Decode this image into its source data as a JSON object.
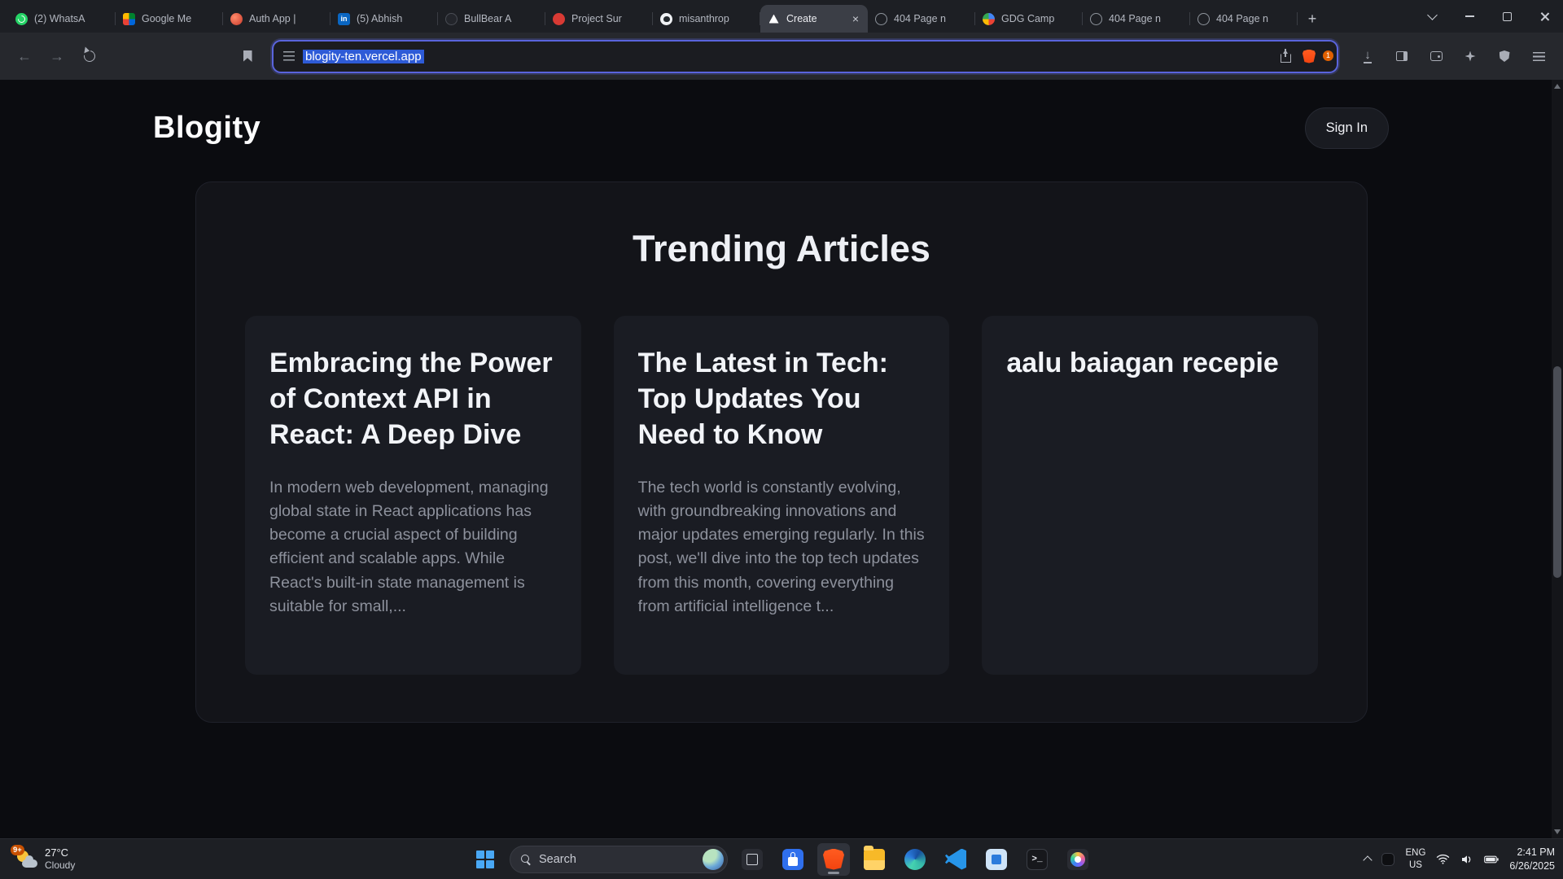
{
  "browser": {
    "tabs": [
      {
        "icon": "whatsapp",
        "title": "(2) WhatsA"
      },
      {
        "icon": "meet",
        "title": "Google Me"
      },
      {
        "icon": "auth",
        "title": "Auth App |"
      },
      {
        "icon": "linkedin",
        "title": "(5) Abhish"
      },
      {
        "icon": "bullbear",
        "title": "BullBear A"
      },
      {
        "icon": "project",
        "title": "Project Sur"
      },
      {
        "icon": "github",
        "title": "misanthrop"
      },
      {
        "icon": "vercel",
        "title": "Create",
        "state": "active",
        "close": "×"
      },
      {
        "icon": "globe",
        "title": "404 Page n"
      },
      {
        "icon": "gdg",
        "title": "GDG Camp"
      },
      {
        "icon": "globe",
        "title": "404 Page n"
      },
      {
        "icon": "globe",
        "title": "404 Page n"
      }
    ],
    "new_tab_glyph": "+",
    "nav_glyphs": {
      "back": "←",
      "forward": "→",
      "download": "↓"
    },
    "url": "blogity-ten.vercel.app",
    "rewards_badge": "1"
  },
  "page": {
    "brand": "Blogity",
    "signin_label": "Sign In",
    "section_title": "Trending Articles",
    "articles": [
      {
        "title": "Embracing the Power of Context API in React: A Deep Dive",
        "excerpt": "In modern web development, managing global state in React applications has become a crucial aspect of building efficient and scalable apps. While React's built-in state management is suitable for small,..."
      },
      {
        "title": "The Latest in Tech: Top Updates You Need to Know",
        "excerpt": "The tech world is constantly evolving, with groundbreaking innovations and major updates emerging regularly. In this post, we'll dive into the top tech updates from this month, covering everything from artificial intelligence t..."
      },
      {
        "title": "aalu baiagan recepie",
        "excerpt": ""
      }
    ]
  },
  "taskbar": {
    "weather": {
      "badge": "9+",
      "temp": "27°C",
      "condition": "Cloudy"
    },
    "search_label": "Search",
    "apps": [
      {
        "icon": "task-view"
      },
      {
        "icon": "store"
      },
      {
        "icon": "brave-app",
        "state": "running"
      },
      {
        "icon": "explorer"
      },
      {
        "icon": "edge"
      },
      {
        "icon": "vscode"
      },
      {
        "icon": "dev"
      },
      {
        "icon": "terminal"
      },
      {
        "icon": "photos"
      }
    ],
    "tray": {
      "lang1": "ENG",
      "lang2": "US",
      "time": "2:41 PM",
      "date": "6/26/2025"
    }
  }
}
